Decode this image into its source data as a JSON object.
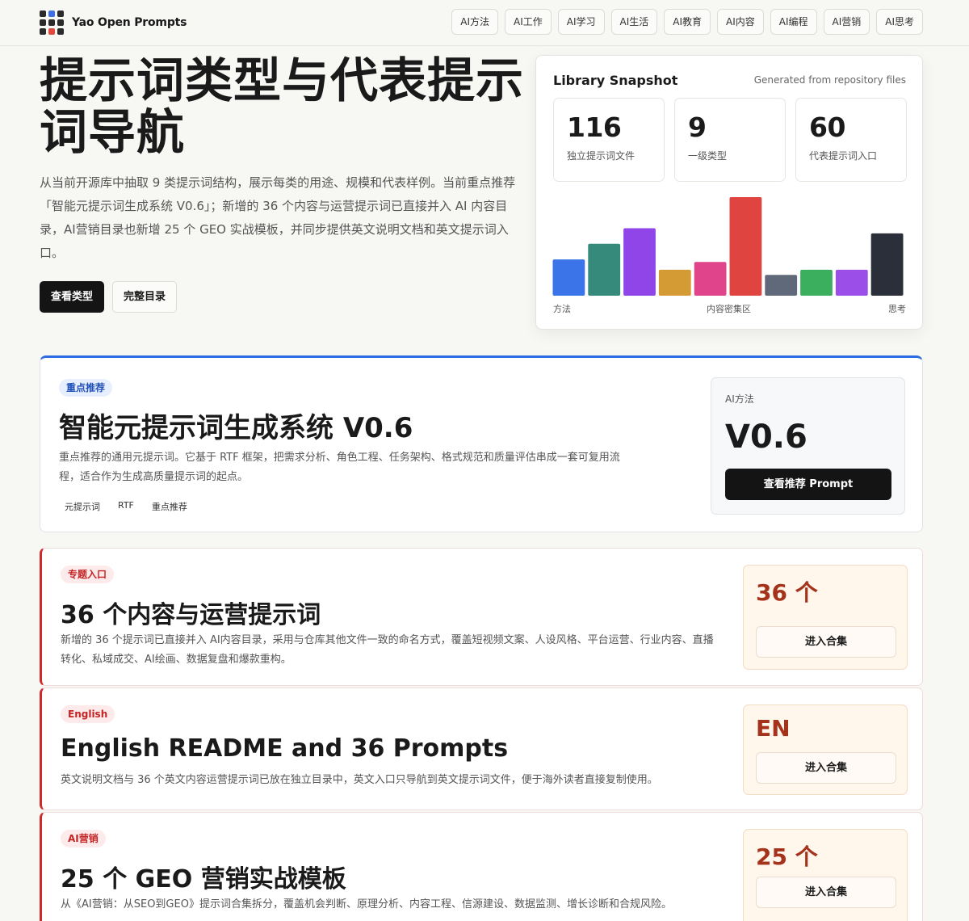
{
  "brand": {
    "name": "Yao Open Prompts",
    "logo_colors": [
      "#2b2b2b",
      "#3f6fe0",
      "#2b2b2b",
      "#2b2b2b",
      "#2b2b2b",
      "#2b2b2b",
      "#2b2b2b",
      "#e04a3f",
      "#2b2b2b"
    ]
  },
  "nav": [
    "AI方法",
    "AI工作",
    "AI学习",
    "AI生活",
    "AI教育",
    "AI内容",
    "AI编程",
    "AI营销",
    "AI思考"
  ],
  "hero": {
    "title": "提示词类型与代表提示词导航",
    "description": "从当前开源库中抽取 9 类提示词结构，展示每类的用途、规模和代表样例。当前重点推荐「智能元提示词生成系统 V0.6」；新增的 36 个内容与运营提示词已直接并入 AI 内容目录，AI营销目录也新增 25 个 GEO 实战模板，并同步提供英文说明文档和英文提示词入口。",
    "primary_button": "查看类型",
    "secondary_button": "完整目录"
  },
  "snapshot": {
    "title": "Library Snapshot",
    "subtitle": "Generated from repository files",
    "stats": [
      {
        "value": "116",
        "label": "独立提示词文件"
      },
      {
        "value": "9",
        "label": "一级类型"
      },
      {
        "value": "60",
        "label": "代表提示词入口"
      }
    ],
    "axis_labels": {
      "left": "方法",
      "middle": "内容密集区",
      "right": "思考"
    }
  },
  "chart_data": {
    "type": "bar",
    "values": [
      14,
      20,
      26,
      10,
      13,
      38,
      8,
      10,
      10,
      24
    ],
    "colors": [
      "#3b73e8",
      "#368a7b",
      "#9045e8",
      "#d49a33",
      "#e0448a",
      "#e04440",
      "#60697a",
      "#3caf5f",
      "#9c4ee8",
      "#2a2f3a"
    ],
    "max": 38,
    "xlabel_left": "方法",
    "xlabel_middle": "内容密集区",
    "xlabel_right": "思考"
  },
  "featured": {
    "tag": "重点推荐",
    "title": "智能元提示词生成系统 V0.6",
    "description": "重点推荐的通用元提示词。它基于 RTF 框架，把需求分析、角色工程、任务架构、格式规范和质量评估串成一套可复用流程，适合作为生成高质量提示词的起点。",
    "chips": [
      "元提示词",
      "RTF",
      "重点推荐"
    ],
    "category": "AI方法",
    "version": "V0.6",
    "button": "查看推荐 Prompt"
  },
  "topics": [
    {
      "tag": "专题入口",
      "title": "36 个内容与运营提示词",
      "description": "新增的 36 个提示词已直接并入 AI内容目录，采用与仓库其他文件一致的命名方式，覆盖短视频文案、人设风格、平台运营、行业内容、直播转化、私域成交、AI绘画、数据复盘和爆款重构。",
      "big": "36 个",
      "button": "进入合集"
    },
    {
      "tag": "English",
      "title": "English README and 36 Prompts",
      "description": "英文说明文档与 36 个英文内容运营提示词已放在独立目录中，英文入口只导航到英文提示词文件，便于海外读者直接复制使用。",
      "big": "EN",
      "button": "进入合集"
    },
    {
      "tag": "AI营销",
      "title": "25 个 GEO 营销实战模板",
      "description": "从《AI营销：从SEO到GEO》提示词合集拆分，覆盖机会判断、原理分析、内容工程、信源建设、数据监测、增长诊断和合规风险。",
      "big": "25 个",
      "button": "进入合集"
    }
  ]
}
